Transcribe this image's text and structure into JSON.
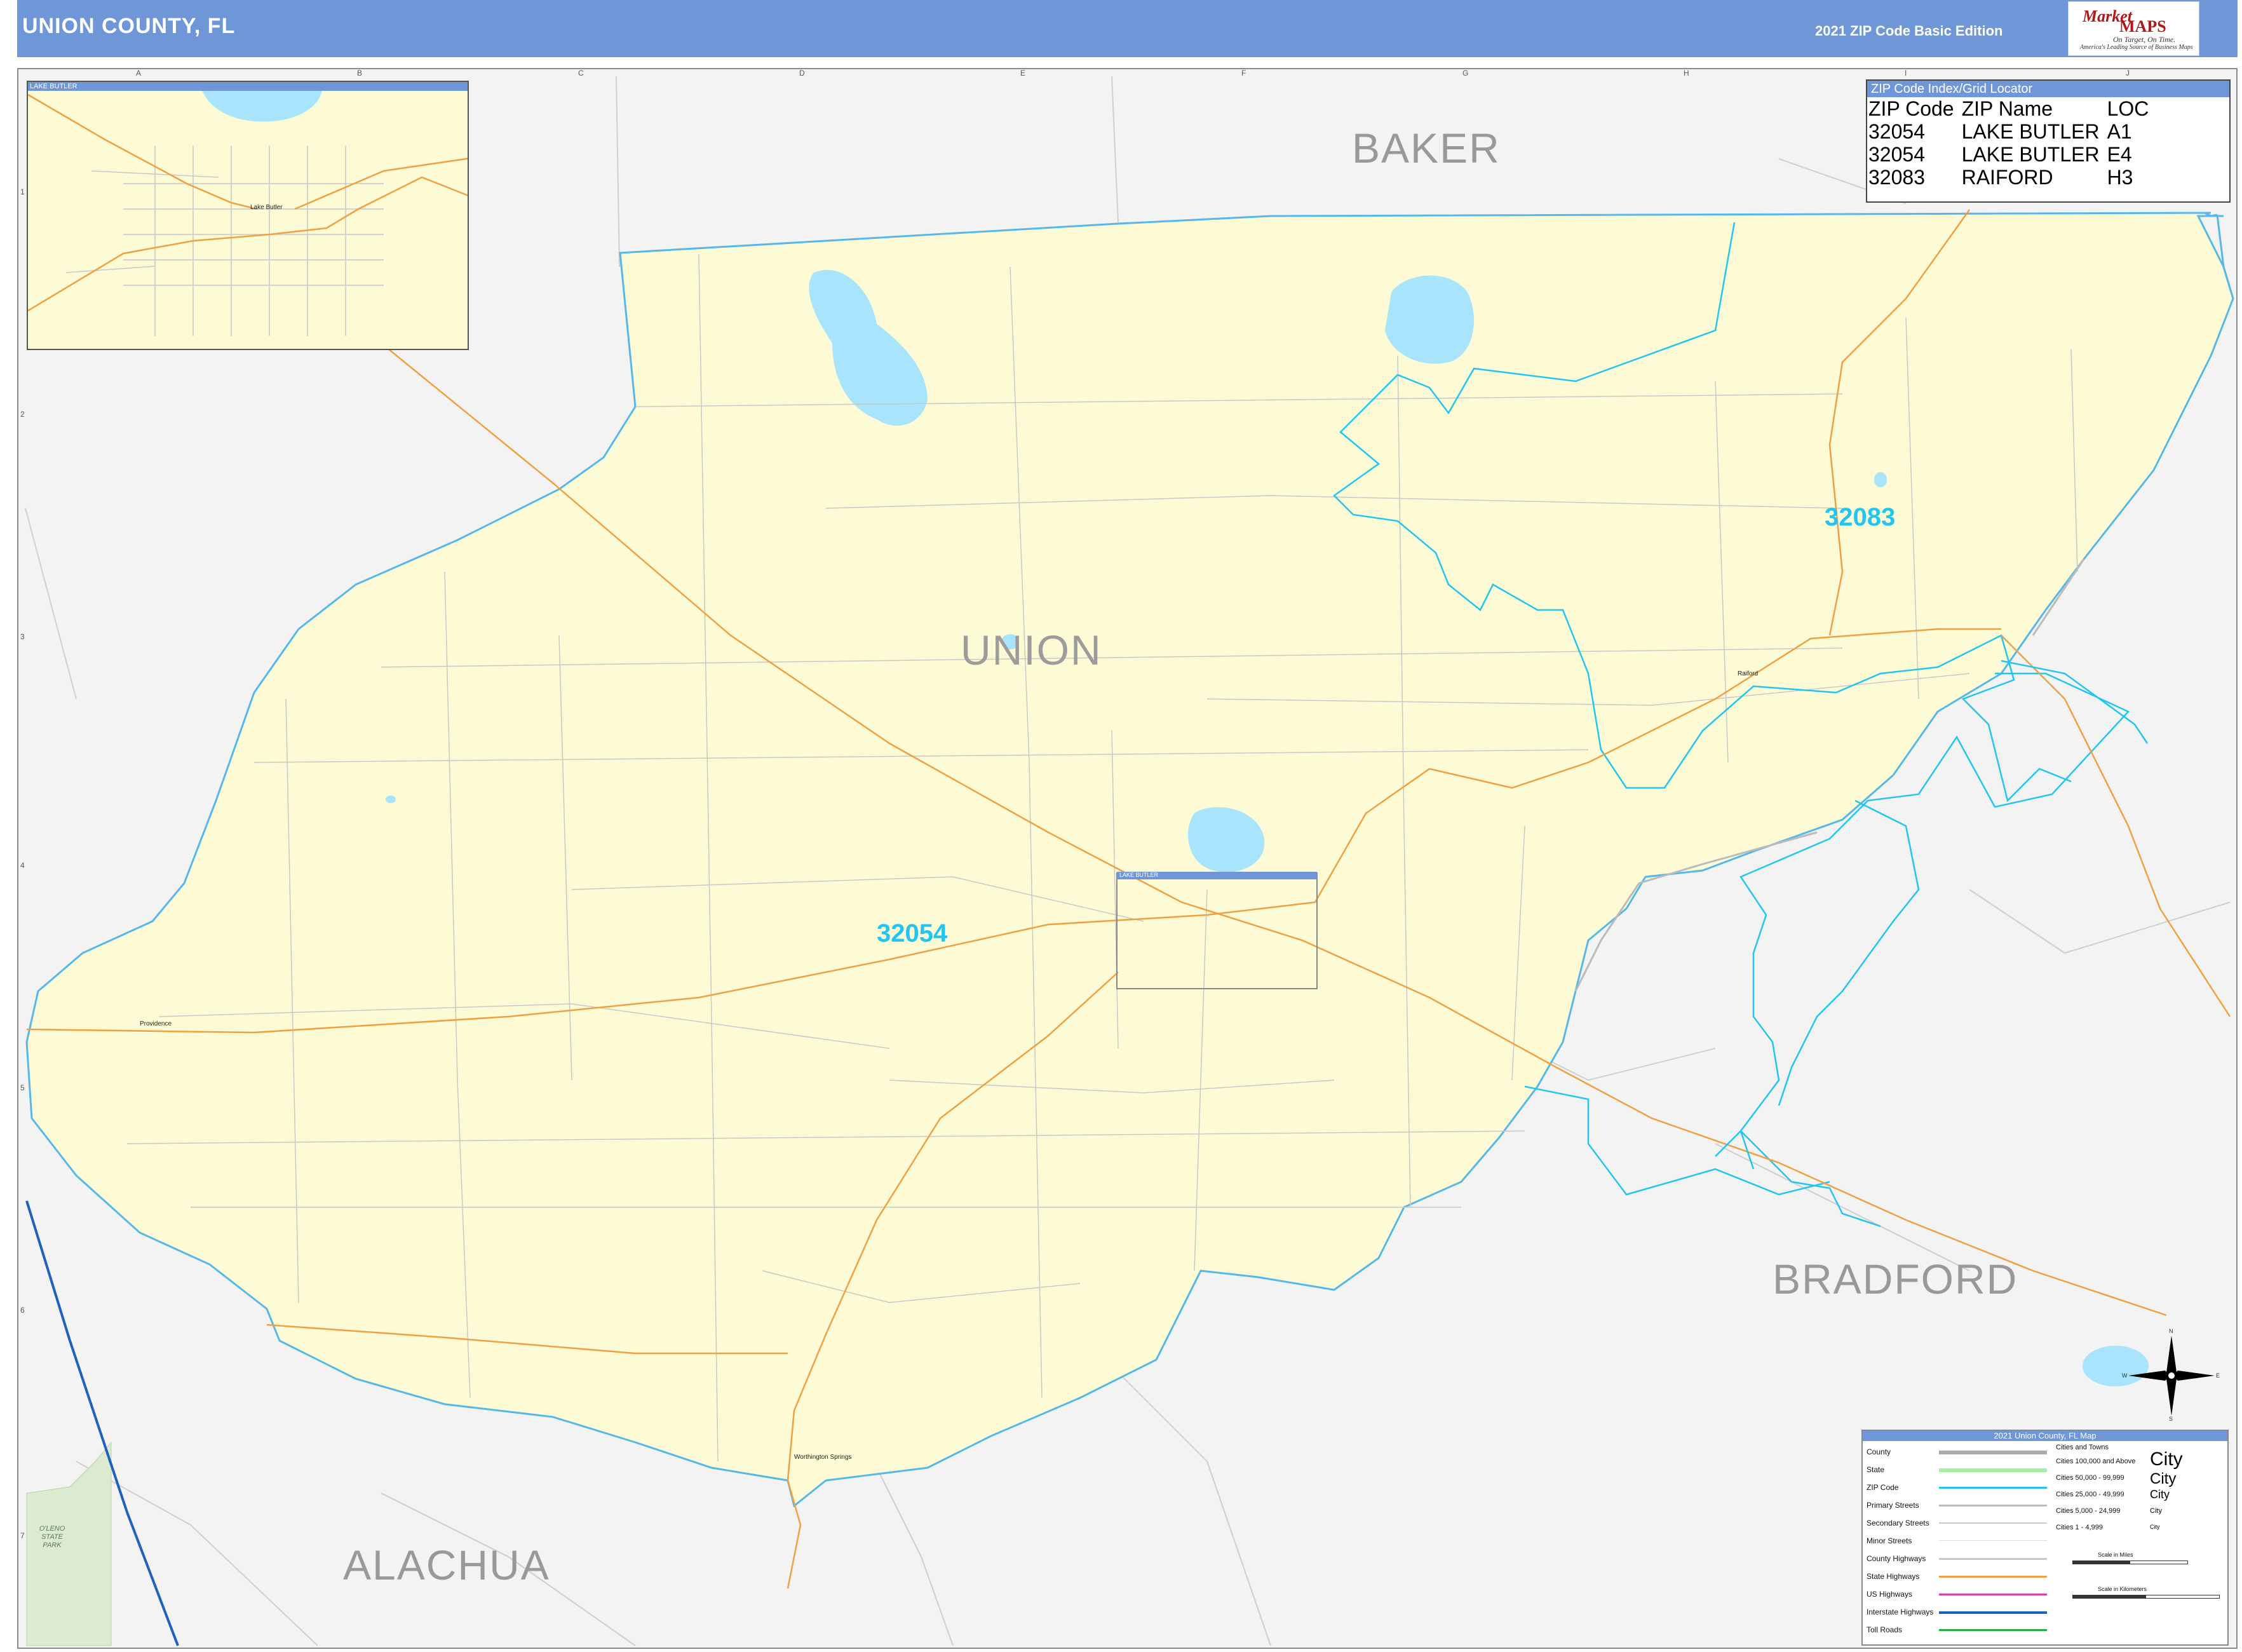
{
  "header": {
    "title": "UNION COUNTY, FL",
    "edition": "2021 ZIP Code Basic Edition",
    "logo": {
      "line1": "Market",
      "line2": "MAPS",
      "tagline": "On Target, On Time.",
      "subtagline": "America's Leading Source of Business Maps"
    }
  },
  "grid": {
    "columns": [
      "A",
      "B",
      "C",
      "D",
      "E",
      "F",
      "G",
      "H",
      "I",
      "J"
    ],
    "rows": [
      "1",
      "2",
      "3",
      "4",
      "5",
      "6",
      "7"
    ]
  },
  "counties": {
    "union": "UNION",
    "baker": "BAKER",
    "bradford": "BRADFORD",
    "alachua": "ALACHUA"
  },
  "zip_labels": {
    "zip1": "32083",
    "zip2": "32054"
  },
  "cities": {
    "raiford": "Raiford",
    "providence": "Providence",
    "worthington": "Worthington Springs",
    "lake_butler": "Lake Butler"
  },
  "park": {
    "line1": "O'LENO",
    "line2": "STATE",
    "line3": "PARK"
  },
  "inset": {
    "title": "LAKE BUTLER",
    "box_label": "LAKE BUTLER"
  },
  "zip_index": {
    "title": "ZIP Code Index/Grid Locator",
    "headers": [
      "ZIP Code",
      "ZIP Name",
      "LOC"
    ],
    "rows": [
      [
        "32054",
        "LAKE BUTLER",
        "A1"
      ],
      [
        "32054",
        "LAKE BUTLER",
        "E4"
      ],
      [
        "32083",
        "RAIFORD",
        "H3"
      ]
    ]
  },
  "legend": {
    "title": "2021 Union County, FL Map",
    "items": [
      {
        "label": "County",
        "color": "#aaaaaa"
      },
      {
        "label": "State",
        "color": "#a5f0a5"
      },
      {
        "label": "ZIP Code",
        "color": "#22c5f0"
      },
      {
        "label": "Primary Streets",
        "color": "#bbbbbb"
      },
      {
        "label": "Secondary Streets",
        "color": "#cccccc"
      },
      {
        "label": "Minor Streets",
        "color": "#dddddd"
      },
      {
        "label": "County Highways",
        "color": "#c8c8c8"
      },
      {
        "label": "State Highways",
        "color": "#f0a040"
      },
      {
        "label": "US Highways",
        "color": "#e040a0"
      },
      {
        "label": "Interstate Highways",
        "color": "#2060c0"
      },
      {
        "label": "Toll Roads",
        "color": "#20b040"
      }
    ],
    "cities_header": "Cities and Towns",
    "city_classes": [
      "Cities 100,000 and Above",
      "Cities 50,000 - 99,999",
      "Cities 25,000 - 49,999",
      "Cities 5,000 - 24,999",
      "Cities 1 - 4,999"
    ],
    "city_sample": "City",
    "scale_miles": "Scale in Miles",
    "scale_km": "Scale in Kilometers"
  },
  "compass": {
    "n": "N",
    "s": "S",
    "e": "E",
    "w": "W"
  },
  "colors": {
    "county_fill": "#fdfbd6",
    "water": "#a8e4fc",
    "zip_boundary": "#22c5f0",
    "state_highway": "#f0a040",
    "interstate": "#2060c0",
    "header": "#6f97d8"
  }
}
